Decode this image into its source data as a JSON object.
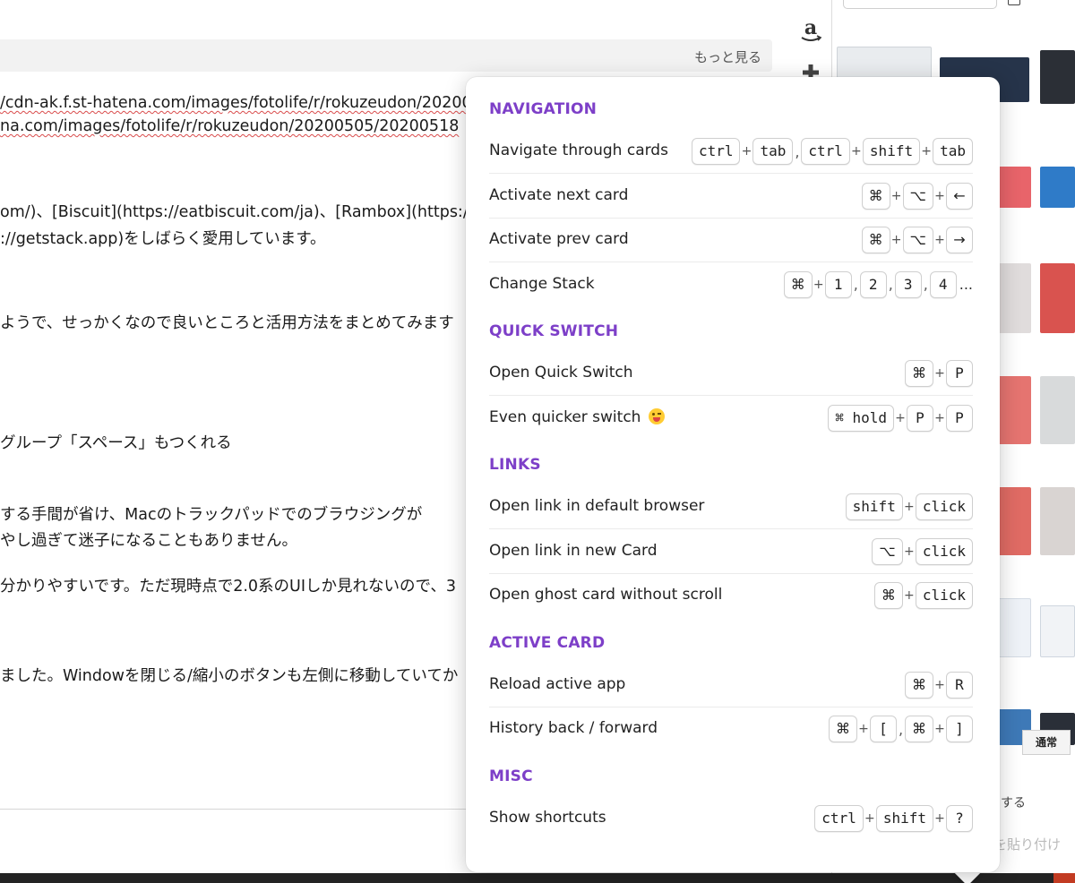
{
  "editor": {
    "more_link": "もっと見る",
    "lines": [
      "/cdn-ak.f.st-hatena.com/images/fotolife/r/rokuzeudon/20200",
      "na.com/images/fotolife/r/rokuzeudon/20200505/20200518",
      "om/)、[Biscuit](https://eatbiscuit.com/ja)、[Rambox](https://r",
      "://getstack.app)をしばらく愛用しています。",
      "ようで、せっかくなので良いところと活用方法をまとめてみます",
      "グループ「スペース」もつくれる",
      "する手間が省け、Macのトラックパッドでのブラウジングが",
      "やし過ぎて迷子になることもありません。",
      "分かりやすいです。ただ現時点で2.0系のUIしか見れないので、3",
      "ました。Windowを閉じる/縮小のボタンも左側に移動していてか"
    ]
  },
  "sidebar": {
    "icons": [
      "amazon-icon",
      "plus-icon"
    ],
    "normal_button": "通常",
    "suru_text": "する",
    "paste_text": "を貼り付け"
  },
  "shortcuts": {
    "sections": [
      {
        "title": "NAVIGATION",
        "rows": [
          {
            "label": "Navigate through cards",
            "keys": [
              "ctrl",
              "tab",
              "ctrl",
              "shift",
              "tab"
            ]
          },
          {
            "label": "Activate next card",
            "keys": [
              "⌘",
              "⌥",
              "←"
            ]
          },
          {
            "label": "Activate prev card",
            "keys": [
              "⌘",
              "⌥",
              "→"
            ]
          },
          {
            "label": "Change Stack",
            "keys": [
              "⌘",
              "1",
              "2",
              "3",
              "4"
            ],
            "suffix": "..."
          }
        ]
      },
      {
        "title": "QUICK SWITCH",
        "rows": [
          {
            "label": "Open Quick Switch",
            "keys": [
              "⌘",
              "P"
            ]
          },
          {
            "label": "Even quicker switch",
            "keys": [
              "⌘ hold",
              "P",
              "P"
            ]
          }
        ]
      },
      {
        "title": "LINKS",
        "rows": [
          {
            "label": "Open link in default browser",
            "keys": [
              "shift",
              "click"
            ]
          },
          {
            "label": "Open link in new Card",
            "keys": [
              "⌥",
              "click"
            ]
          },
          {
            "label": "Open ghost card without scroll",
            "keys": [
              "⌘",
              "click"
            ]
          }
        ]
      },
      {
        "title": "ACTIVE CARD",
        "rows": [
          {
            "label": "Reload active app",
            "keys": [
              "⌘",
              "R"
            ]
          },
          {
            "label": "History back / forward",
            "keys": [
              "⌘",
              "[",
              "⌘",
              "]"
            ]
          }
        ]
      },
      {
        "title": "MISC",
        "rows": [
          {
            "label": "Show shortcuts",
            "keys": [
              "ctrl",
              "shift",
              "?"
            ]
          }
        ]
      }
    ]
  }
}
